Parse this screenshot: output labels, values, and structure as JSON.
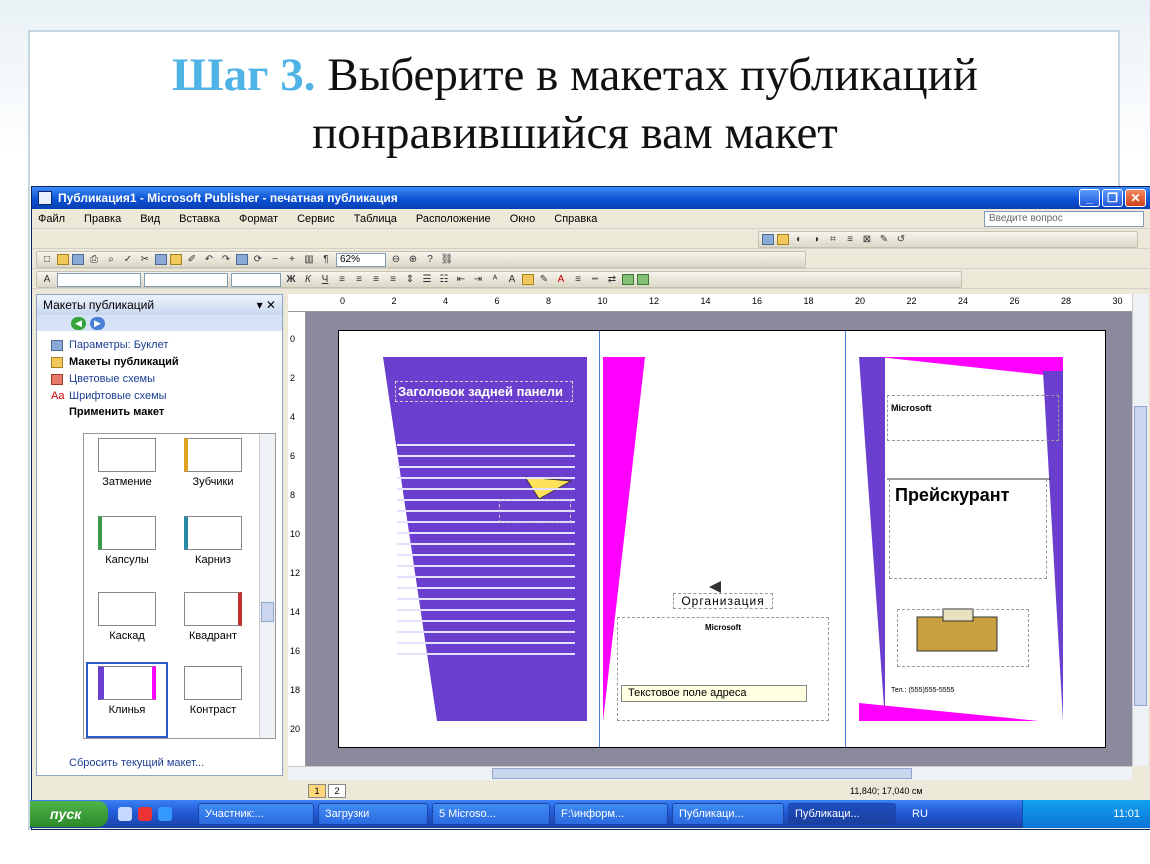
{
  "slide": {
    "step": "Шаг 3.",
    "line1": " Выберите в макетах публикаций",
    "line2": "понравившийся вам макет"
  },
  "window": {
    "title": "Публикация1 - Microsoft Publisher - печатная публикация"
  },
  "menu": {
    "items": [
      "Файл",
      "Правка",
      "Вид",
      "Вставка",
      "Формат",
      "Сервис",
      "Таблица",
      "Расположение",
      "Окно",
      "Справка"
    ],
    "help_placeholder": "Введите вопрос"
  },
  "toolbar": {
    "zoom": "62%",
    "bold": "Ж",
    "italic": "К",
    "underline": "Ч"
  },
  "pane": {
    "title": "Макеты публикаций",
    "links": [
      {
        "label": "Параметры: Буклет"
      },
      {
        "label": "Макеты публикаций"
      },
      {
        "label": "Цветовые схемы"
      },
      {
        "label": "Шрифтовые схемы"
      }
    ],
    "apply_label": "Применить макет",
    "layouts": [
      "Затмение",
      "Зубчики",
      "Капсулы",
      "Карниз",
      "Каскад",
      "Квадрант",
      "Клинья",
      "Контраст"
    ],
    "selected_layout": "Клинья",
    "reset": "Сбросить текущий макет..."
  },
  "rulers": {
    "top": [
      "0",
      "2",
      "4",
      "6",
      "8",
      "10",
      "12",
      "14",
      "16",
      "18",
      "20",
      "22",
      "24",
      "26",
      "28",
      "30"
    ],
    "left": [
      "0",
      "2",
      "4",
      "6",
      "8",
      "10",
      "12",
      "14",
      "16",
      "18",
      "20"
    ]
  },
  "publication": {
    "back_panel_title": "Заголовок задней панели",
    "organization": "Организация",
    "company": "Microsoft",
    "address_field": "Текстовое поле адреса",
    "price_list": "Прейскурант",
    "phone": "Тел.: (555)555-5555",
    "colors": {
      "purple": "#6a3fcf",
      "magenta": "#ff00ff"
    }
  },
  "status": {
    "pages": [
      "1",
      "2"
    ],
    "coords": "11,840; 17,040 см"
  },
  "taskbar": {
    "start": "пуск",
    "tasks": [
      "Участник:...",
      "Загрузки",
      "5 Microso...",
      "F:\\информ...",
      "Публикаци...",
      "Публикаци..."
    ],
    "lang": "RU",
    "clock": "11:01"
  }
}
